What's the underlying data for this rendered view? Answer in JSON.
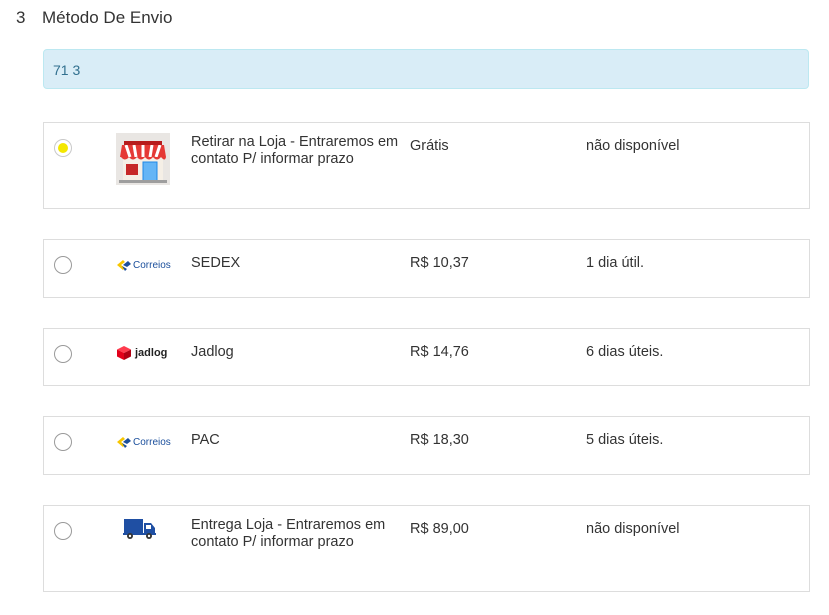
{
  "section": {
    "step": "3",
    "title": "Método De Envio"
  },
  "zip": {
    "value": "71 3"
  },
  "options": [
    {
      "name": "Retirar na Loja - Entraremos em contato P/ informar prazo",
      "price": "Grátis",
      "eta": "não disponível",
      "icon": "store-icon",
      "selected": true
    },
    {
      "name": "SEDEX",
      "price": "R$ 10,37",
      "eta": "1 dia útil.",
      "icon": "correios-logo",
      "logo_text": "Correios",
      "selected": false
    },
    {
      "name": "Jadlog",
      "price": "R$ 14,76",
      "eta": "6 dias úteis.",
      "icon": "jadlog-logo",
      "logo_text": "jadlog",
      "selected": false
    },
    {
      "name": "PAC",
      "price": "R$ 18,30",
      "eta": "5 dias úteis.",
      "icon": "correios-logo",
      "logo_text": "Correios",
      "selected": false
    },
    {
      "name": "Entrega Loja - Entraremos em contato P/ informar prazo",
      "price": "R$ 89,00",
      "eta": "não disponível",
      "icon": "delivery-truck-icon",
      "selected": false
    }
  ],
  "colors": {
    "zip_bg": "#d9edf7",
    "zip_text": "#31708f",
    "selected_radio": "#f4e700",
    "correios_blue": "#1b4f9c",
    "correios_yellow": "#f7c600",
    "jadlog_red": "#e2001a",
    "truck_blue": "#1f4fa3",
    "store_red": "#e53935"
  }
}
